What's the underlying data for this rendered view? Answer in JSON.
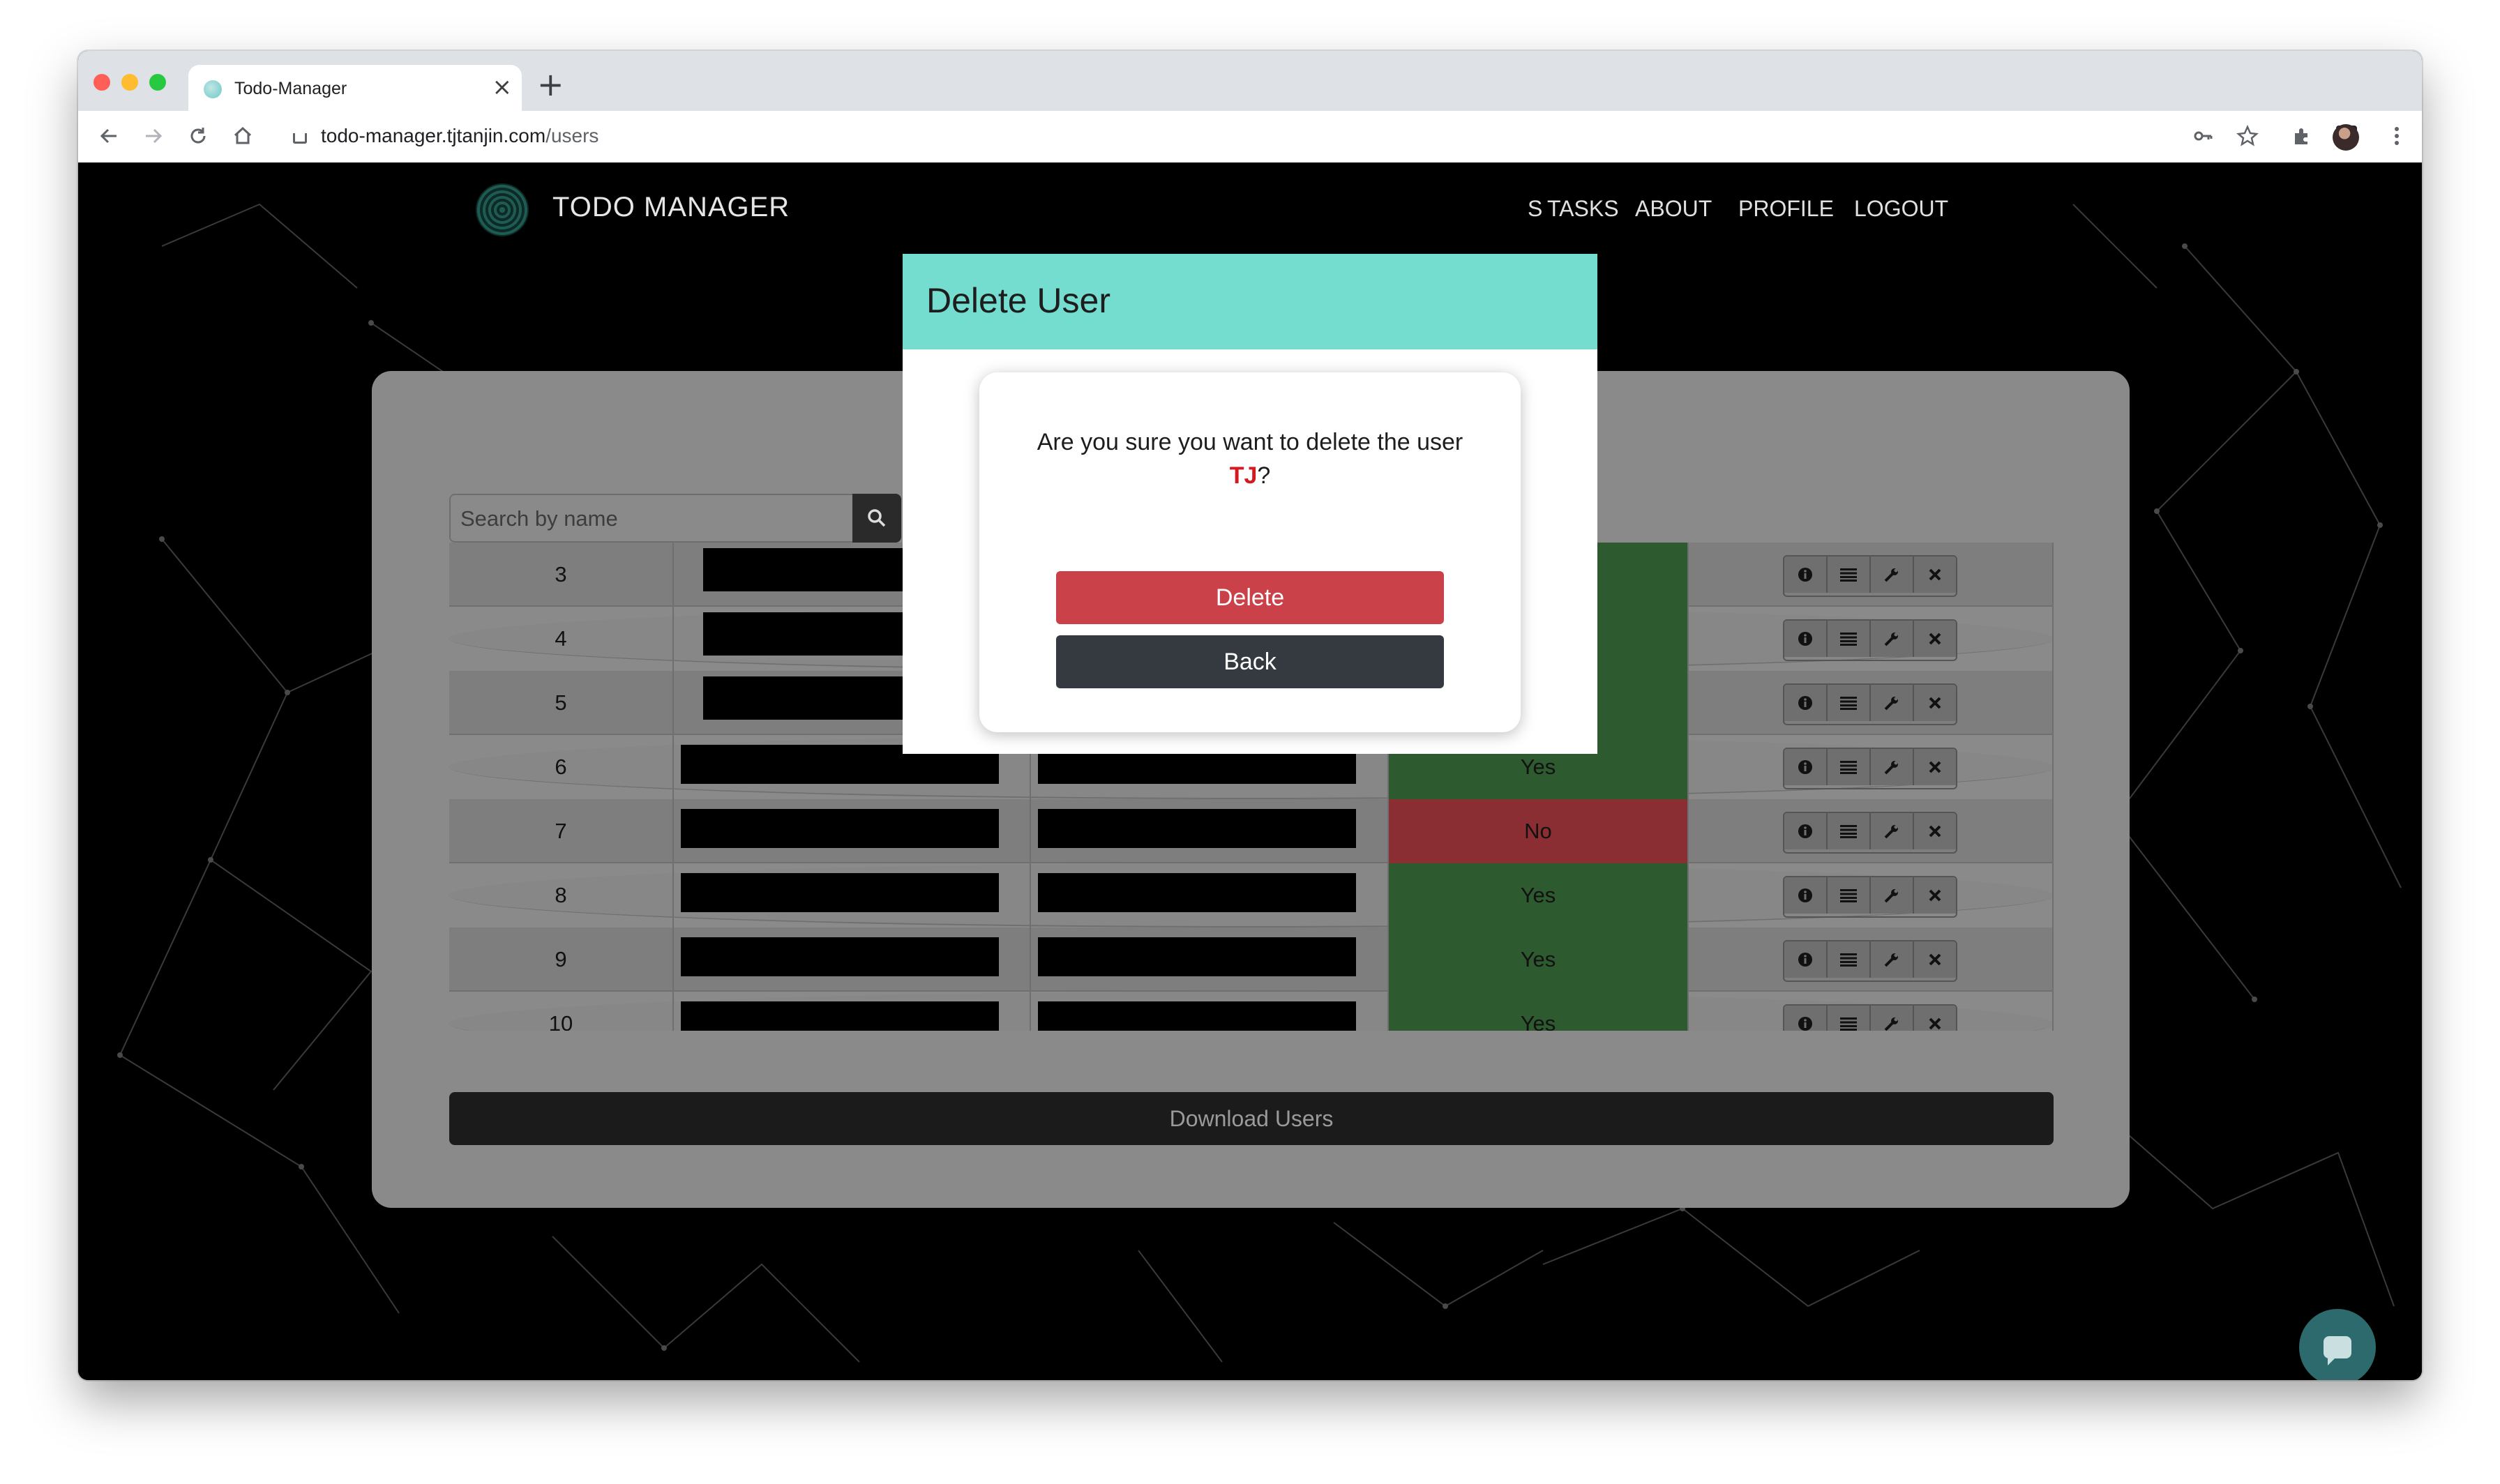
{
  "browser": {
    "tab_title": "Todo-Manager",
    "tab_close": "×",
    "new_tab": "+",
    "url_host": "todo-manager.tjtanjin.com",
    "url_path": "/users"
  },
  "header": {
    "brand": "TODO MANAGER",
    "nav_items": [
      "S",
      "TASKS",
      "ABOUT",
      "PROFILE",
      "LOGOUT"
    ]
  },
  "search": {
    "placeholder": "Search by name"
  },
  "table": {
    "rows": [
      {
        "id": "3",
        "status": "",
        "status_kind": "yes"
      },
      {
        "id": "4",
        "status": "",
        "status_kind": "yes"
      },
      {
        "id": "5",
        "status": "",
        "status_kind": "yes"
      },
      {
        "id": "6",
        "status": "Yes",
        "status_kind": "yes"
      },
      {
        "id": "7",
        "status": "No",
        "status_kind": "no"
      },
      {
        "id": "8",
        "status": "Yes",
        "status_kind": "yes"
      },
      {
        "id": "9",
        "status": "Yes",
        "status_kind": "yes"
      },
      {
        "id": "10",
        "status": "Yes",
        "status_kind": "yes"
      }
    ],
    "action_icons": [
      "info-icon",
      "list-icon",
      "wrench-icon",
      "close-icon"
    ]
  },
  "download_label": "Download Users",
  "modal": {
    "title": "Delete User",
    "message_prefix": "Are you sure you want to delete the user ",
    "username": "TJ",
    "message_suffix": "?",
    "delete_label": "Delete",
    "back_label": "Back"
  },
  "colors": {
    "modal_header": "#74ddd0",
    "delete_button": "#cb4149",
    "back_button": "#343a40",
    "status_yes": "#2d5a2e",
    "status_no": "#8b2e33"
  }
}
